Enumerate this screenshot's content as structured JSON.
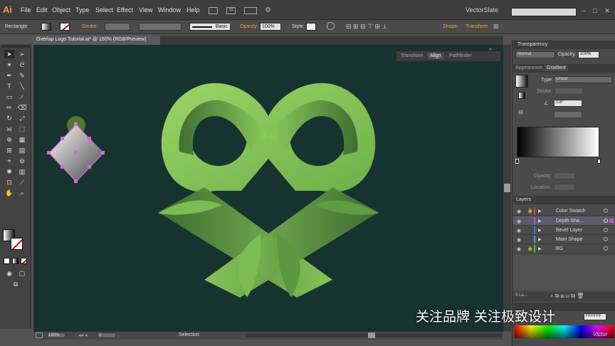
{
  "app": {
    "logo": "Ai",
    "workspace": "VectorSlate",
    "search_placeholder": "",
    "window_buttons": [
      "–",
      "□",
      "✕"
    ]
  },
  "menu": [
    "File",
    "Edit",
    "Object",
    "Type",
    "Select",
    "Effect",
    "View",
    "Window",
    "Help"
  ],
  "control_bar": {
    "selection_label": "Rectangle",
    "stroke_label": "Stroke:",
    "brush_label": "Basic",
    "opacity_label": "Opacity:",
    "opacity_value": "100%",
    "style_label": "Style:",
    "shape_label": "Shape:",
    "transform_label": "Transform"
  },
  "document": {
    "tab_title": "Overlap Logo Tutorial.ai* @ 150% (RGB/Preview)"
  },
  "float_panel": {
    "tabs": [
      "Transform",
      "Align",
      "Pathfinder"
    ]
  },
  "status": {
    "zoom": "150%",
    "artboard": "1",
    "tool": "Selection"
  },
  "transparency": {
    "title": "Transparency",
    "blend_mode": "Normal",
    "opacity_label": "Opacity:",
    "opacity_value": "100%"
  },
  "gradient": {
    "tabs": [
      "Appearance",
      "Gradient"
    ],
    "type_label": "Type:",
    "type_value": "Linear",
    "stroke_label": "Stroke:",
    "angle_value": "0.8°",
    "opacity_label": "Opacity:",
    "location_label": "Location:"
  },
  "layers": {
    "title": "Layers",
    "items": [
      {
        "name": "Color Swatch",
        "color": "#e04040"
      },
      {
        "name": "Depth Sha...",
        "color": "#c050d0"
      },
      {
        "name": "Bevel Layer",
        "color": "#5070e0"
      },
      {
        "name": "Main Shape",
        "color": "#30b0b0"
      },
      {
        "name": "BG",
        "color": "#40c040"
      }
    ],
    "footer": "5 La..."
  },
  "color_panel": {
    "hex_value": "FFFFFF"
  },
  "overlay": {
    "subtitle": "关注品牌 关注极致设计",
    "watermark": "Victor"
  },
  "colors": {
    "canvas": "#16332f",
    "heart_light": "#8fcb5e",
    "heart_dark": "#3f7030",
    "selection": "#d864e0"
  }
}
